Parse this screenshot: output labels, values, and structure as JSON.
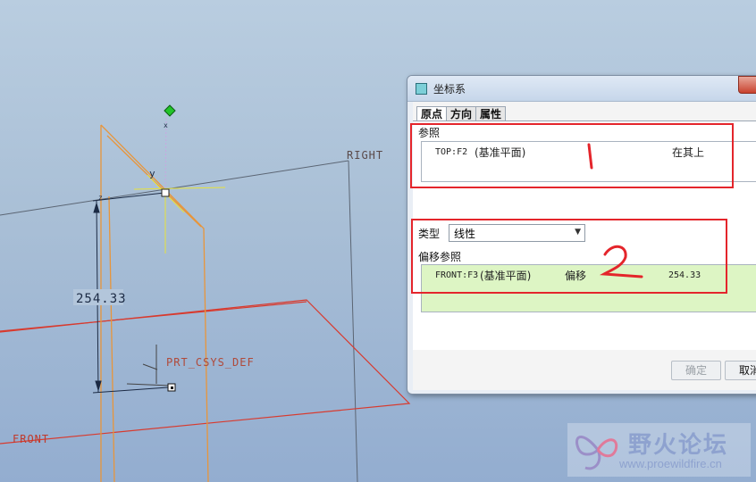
{
  "viewport": {
    "labels": {
      "right": "RIGHT",
      "front": "FRONT",
      "csys": "PRT_CSYS_DEF",
      "dimension": "254.33",
      "axis_y": "y",
      "axis_z": "z",
      "axis_x": "x"
    }
  },
  "dialog": {
    "title": "坐标系",
    "tabs": [
      "原点",
      "方向",
      "属性"
    ],
    "references": {
      "label": "参照",
      "row": {
        "ref": "TOP:F2",
        "type": "(基准平面)",
        "constraint": "在其上"
      }
    },
    "type": {
      "label": "类型",
      "value": "线性"
    },
    "offset_references": {
      "label": "偏移参照",
      "row": {
        "ref": "FRONT:F3",
        "type": "(基准平面)",
        "constraint": "偏移",
        "value": "254.33"
      }
    },
    "buttons": {
      "ok": "确定",
      "cancel": "取消"
    }
  },
  "annotations": {
    "one": "1",
    "two": "2"
  },
  "watermark": {
    "title": "野火论坛",
    "url": "www.proewildfire.cn"
  },
  "colors": {
    "background": "#aac0d8",
    "datum_line": "#e8953a",
    "datum_plane": "#d83a2e",
    "annotation": "#e4252b",
    "offset_fill": "#ddf5c4",
    "handle": "#22c42a"
  }
}
